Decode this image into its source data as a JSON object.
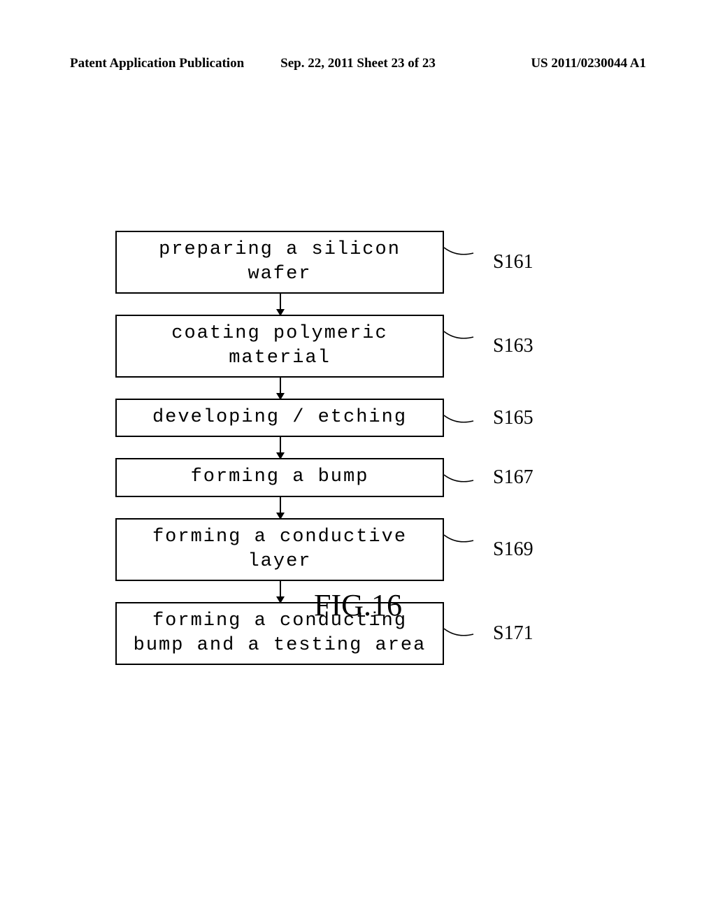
{
  "header": {
    "left": "Patent Application Publication",
    "center": "Sep. 22, 2011  Sheet 23 of 23",
    "right": "US 2011/0230044 A1"
  },
  "chart_data": {
    "type": "flowchart",
    "title": "FIG.16",
    "steps": [
      {
        "id": "S161",
        "text": "preparing a silicon wafer"
      },
      {
        "id": "S163",
        "text": "coating polymeric material"
      },
      {
        "id": "S165",
        "text": "developing / etching"
      },
      {
        "id": "S167",
        "text": "forming a bump"
      },
      {
        "id": "S169",
        "text": "forming a conductive layer"
      },
      {
        "id": "S171",
        "text": "forming a conducting bump and a testing area"
      }
    ]
  },
  "figure_label": "FIG.16"
}
